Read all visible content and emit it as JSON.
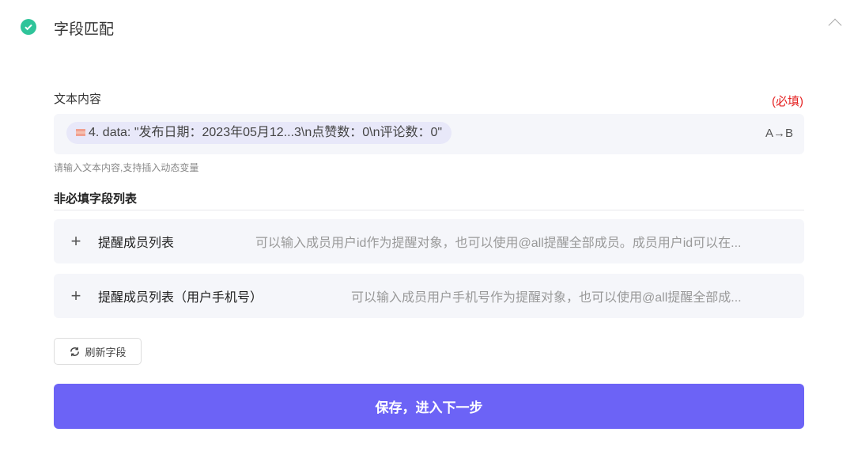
{
  "header": {
    "title": "字段匹配",
    "status_icon": "check-circle-icon",
    "collapse_icon": "chevron-up-icon"
  },
  "text_field": {
    "label": "文本内容",
    "required": "(必填)",
    "chip": "4. data: \"发布日期：2023年05月12...3\\n点赞数：0\\n评论数：0\"",
    "transform": "A→B",
    "hint": "请输入文本内容,支持插入动态变量"
  },
  "optional": {
    "title": "非必填字段列表",
    "items": [
      {
        "name": "提醒成员列表",
        "desc": "可以输入成员用户id作为提醒对象，也可以使用@all提醒全部成员。成员用户id可以在..."
      },
      {
        "name": "提醒成员列表（用户手机号）",
        "desc": "可以输入成员用户手机号作为提醒对象，也可以使用@all提醒全部成..."
      }
    ]
  },
  "refresh_label": "刷新字段",
  "save_label": "保存，进入下一步",
  "colors": {
    "accent": "#6c63f6",
    "success": "#2fc49a",
    "required": "#e52222"
  }
}
